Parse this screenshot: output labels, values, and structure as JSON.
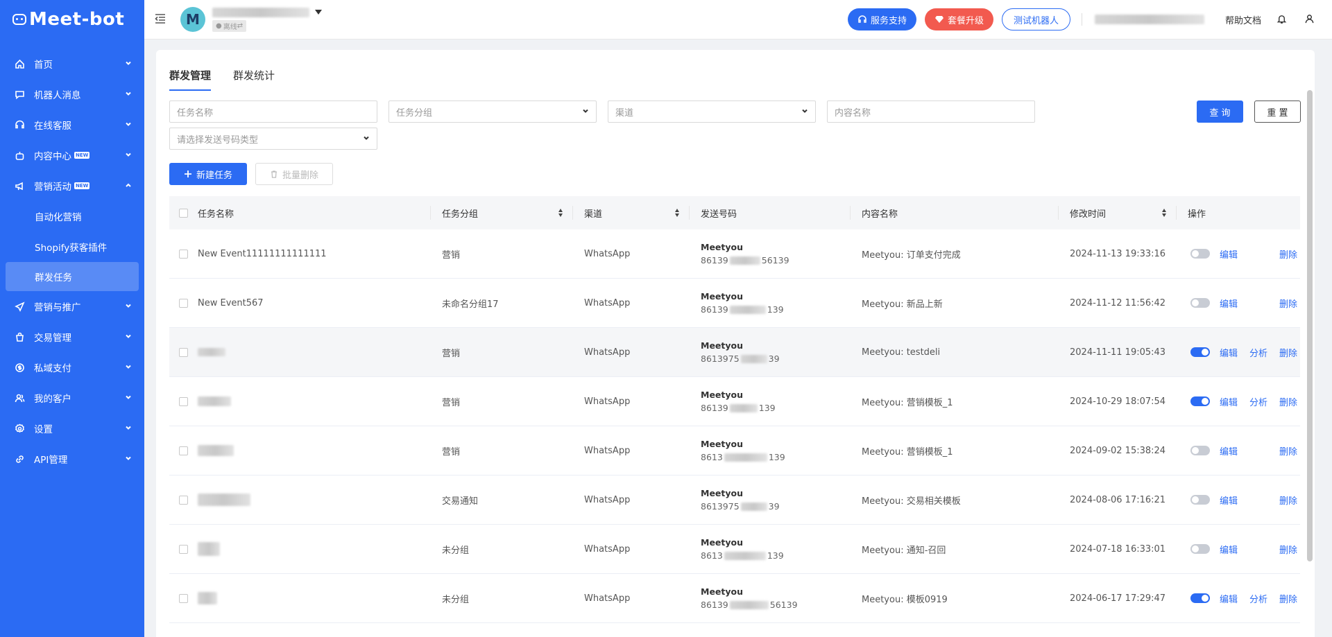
{
  "sidebar": {
    "brand": "Meet-bot",
    "new_badge": "NEW",
    "items": [
      {
        "label": "首页",
        "icon": "home-icon",
        "expanded": false
      },
      {
        "label": "机器人消息",
        "icon": "chat-icon",
        "expanded": false
      },
      {
        "label": "在线客服",
        "icon": "headset-icon",
        "expanded": false
      },
      {
        "label": "内容中心",
        "icon": "robot-icon",
        "badge": true,
        "expanded": false
      },
      {
        "label": "营销活动",
        "icon": "megaphone-icon",
        "badge": true,
        "expanded": true
      },
      {
        "label": "营销与推广",
        "icon": "send-icon",
        "expanded": false
      },
      {
        "label": "交易管理",
        "icon": "bag-icon",
        "expanded": false
      },
      {
        "label": "私域支付",
        "icon": "dollar-icon",
        "expanded": false
      },
      {
        "label": "我的客户",
        "icon": "users-icon",
        "expanded": false
      },
      {
        "label": "设置",
        "icon": "gear-icon",
        "expanded": false
      },
      {
        "label": "API管理",
        "icon": "link-icon",
        "expanded": false
      }
    ],
    "subitems": [
      "自动化营销",
      "Shopify获客插件",
      "群发任务"
    ],
    "active_subitem": "群发任务"
  },
  "header": {
    "avatar_letter": "M",
    "status": "离线",
    "service_support": "服务支持",
    "upgrade": "套餐升级",
    "test_bot": "测试机器人",
    "help_docs": "帮助文档"
  },
  "tabs": [
    {
      "label": "群发管理",
      "active": true
    },
    {
      "label": "群发统计",
      "active": false
    }
  ],
  "filters": {
    "task_name_placeholder": "任务名称",
    "task_group_placeholder": "任务分组",
    "channel_placeholder": "渠道",
    "content_name_placeholder": "内容名称",
    "send_type_placeholder": "请选择发送号码类型"
  },
  "buttons": {
    "query": "查 询",
    "reset": "重 置",
    "new_task": "新建任务",
    "batch_delete": "批量删除"
  },
  "table": {
    "columns": [
      "任务名称",
      "任务分组",
      "渠道",
      "发送号码",
      "内容名称",
      "修改时间",
      "操作"
    ],
    "op_edit": "编辑",
    "op_analyze": "分析",
    "op_delete": "删除",
    "rows": [
      {
        "name": "New Event11111111111111",
        "group": "营销",
        "channel": "WhatsApp",
        "sender": "Meetyou",
        "num_pre": "86139",
        "num_post": "56139",
        "content": "Meetyou: 订单支付完成",
        "time": "2024-11-13 19:33:16",
        "enabled": false,
        "analyze": false,
        "highlight": false
      },
      {
        "name": "New Event567",
        "group": "未命名分组17",
        "channel": "WhatsApp",
        "sender": "Meetyou",
        "num_pre": "86139",
        "num_post": "139",
        "content": "Meetyou: 新品上新",
        "time": "2024-11-12 11:56:42",
        "enabled": false,
        "analyze": false,
        "highlight": false
      },
      {
        "name": "",
        "group": "营销",
        "channel": "WhatsApp",
        "sender": "Meetyou",
        "num_pre": "8613975",
        "num_post": "39",
        "content": "Meetyou: testdeli",
        "time": "2024-11-11 19:05:43",
        "enabled": true,
        "analyze": true,
        "highlight": true,
        "analyze_boxed": true
      },
      {
        "name": "",
        "group": "营销",
        "channel": "WhatsApp",
        "sender": "Meetyou",
        "num_pre": "86139",
        "num_post": "139",
        "content": "Meetyou: 营销模板_1",
        "time": "2024-10-29 18:07:54",
        "enabled": true,
        "analyze": true,
        "highlight": false
      },
      {
        "name": "",
        "group": "营销",
        "channel": "WhatsApp",
        "sender": "Meetyou",
        "num_pre": "8613",
        "num_post": "139",
        "content": "Meetyou: 营销模板_1",
        "time": "2024-09-02 15:38:24",
        "enabled": false,
        "analyze": false,
        "highlight": false
      },
      {
        "name": "",
        "group": "交易通知",
        "channel": "WhatsApp",
        "sender": "Meetyou",
        "num_pre": "8613975",
        "num_post": "39",
        "content": "Meetyou: 交易相关模板",
        "time": "2024-08-06 17:16:21",
        "enabled": false,
        "analyze": false,
        "highlight": false
      },
      {
        "name": "",
        "group": "未分组",
        "channel": "WhatsApp",
        "sender": "Meetyou",
        "num_pre": "8613",
        "num_post": "139",
        "content": "Meetyou: 通知-召回",
        "time": "2024-07-18 16:33:01",
        "enabled": false,
        "analyze": false,
        "highlight": false
      },
      {
        "name": "",
        "group": "未分组",
        "channel": "WhatsApp",
        "sender": "Meetyou",
        "num_pre": "86139",
        "num_post": "56139",
        "content": "Meetyou: 模板0919",
        "time": "2024-06-17 17:29:47",
        "enabled": true,
        "analyze": true,
        "highlight": false
      }
    ]
  }
}
